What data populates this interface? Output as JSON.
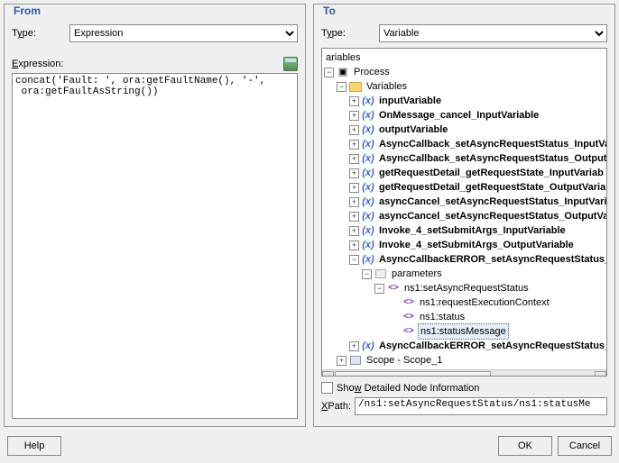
{
  "from": {
    "title": "From",
    "type_label": "Type:",
    "type_value": "Expression",
    "expr_label": "Expression:",
    "expr_value": "concat('Fault: ', ora:getFaultName(), '-',\n ora:getFaultAsString())"
  },
  "to": {
    "title": "To",
    "type_label": "Type:",
    "type_value": "Variable",
    "tree": {
      "root": "ariables",
      "process": "Process",
      "variables_folder": "Variables",
      "items": [
        "inputVariable",
        "OnMessage_cancel_InputVariable",
        "outputVariable",
        "AsyncCallback_setAsyncRequestStatus_InputVa",
        "AsyncCallback_setAsyncRequestStatus_Output",
        "getRequestDetail_getRequestState_InputVariab",
        "getRequestDetail_getRequestState_OutputVaria",
        "asyncCancel_setAsyncRequestStatus_InputVari",
        "asyncCancel_setAsyncRequestStatus_OutputVa",
        "Invoke_4_setSubmitArgs_InputVariable",
        "Invoke_4_setSubmitArgs_OutputVariable",
        "AsyncCallbackERROR_setAsyncRequestStatus_"
      ],
      "parameters": "parameters",
      "set_async": "ns1:setAsyncRequestStatus",
      "children": [
        "ns1:requestExecutionContext",
        "ns1:status",
        "ns1:statusMessage"
      ],
      "last_var": "AsyncCallbackERROR_setAsyncRequestStatus_",
      "scope": "Scope - Scope_1"
    },
    "show_detail": "Show Detailed Node Information",
    "xpath_label": "XPath:",
    "xpath_value": "/ns1:setAsyncRequestStatus/ns1:statusMe"
  },
  "buttons": {
    "help": "Help",
    "ok": "OK",
    "cancel": "Cancel"
  }
}
